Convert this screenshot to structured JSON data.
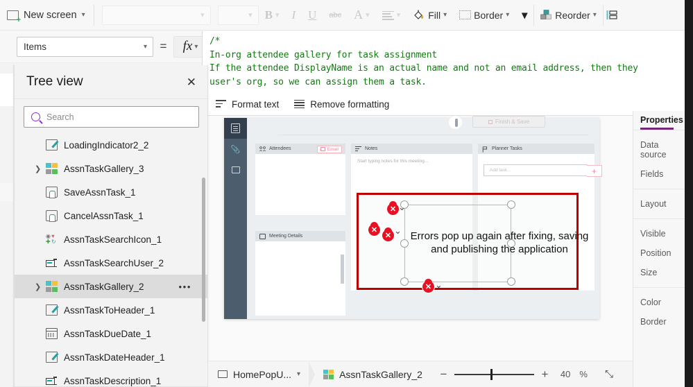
{
  "command_bar": {
    "new_screen": "New screen",
    "font_select_value": "",
    "size_select_value": "",
    "bold": "B",
    "italic": "I",
    "underline": "U",
    "strikethrough": "abc",
    "font_color": "A",
    "align": "align-icon",
    "fill": "Fill",
    "border": "Border",
    "overflow": "chevron-down",
    "reorder": "Reorder",
    "align_right": "align-icon"
  },
  "formula_bar": {
    "property": "Items",
    "equals": "=",
    "fx": "fx",
    "lines": [
      "/*",
      "In-org attendee gallery for task assignment",
      "If the attendee DisplayName is an actual name and not an email address, then they",
      "user's org, so we can assign them a task."
    ]
  },
  "format_toolbar": {
    "format_text": "Format text",
    "remove_formatting": "Remove formatting"
  },
  "tree_view": {
    "title": "Tree view",
    "close": "✕",
    "search_placeholder": "Search",
    "items": [
      {
        "label": "LoadingIndicator2_2",
        "icon": "pencil-icon",
        "expandable": false,
        "selected": false
      },
      {
        "label": "AssnTaskGallery_3",
        "icon": "gallery-icon",
        "expandable": true,
        "selected": false
      },
      {
        "label": "SaveAssnTask_1",
        "icon": "button-icon",
        "expandable": false,
        "selected": false
      },
      {
        "label": "CancelAssnTask_1",
        "icon": "button-icon",
        "expandable": false,
        "selected": false
      },
      {
        "label": "AssnTaskSearchIcon_1",
        "icon": "add-icon",
        "expandable": false,
        "selected": false
      },
      {
        "label": "AssnTaskSearchUser_2",
        "icon": "textinput-icon",
        "expandable": false,
        "selected": false
      },
      {
        "label": "AssnTaskGallery_2",
        "icon": "gallery-icon",
        "expandable": true,
        "selected": true,
        "menu": "•••"
      },
      {
        "label": "AssnTaskToHeader_1",
        "icon": "pencil-icon",
        "expandable": false,
        "selected": false
      },
      {
        "label": "AssnTaskDueDate_1",
        "icon": "calendar-icon",
        "expandable": false,
        "selected": false
      },
      {
        "label": "AssnTaskDateHeader_1",
        "icon": "pencil-icon",
        "expandable": false,
        "selected": false
      },
      {
        "label": "AssnTaskDescription_1",
        "icon": "textinput-icon",
        "expandable": false,
        "selected": false
      }
    ]
  },
  "canvas": {
    "finish_save": "Finish & Save",
    "panels": {
      "attendees": "Attendees",
      "email_badge": "Email",
      "meeting_details": "Meeting Details",
      "notes": "Notes",
      "notes_placeholder": "Start typing notes for this meeting...",
      "planner_tasks": "Planner Tasks",
      "add_task_placeholder": "Add task...",
      "add_task_button": "+"
    },
    "error_message_line1": "Errors pop up again after fixing, saving",
    "error_message_line2": "and publishing the application",
    "error_badges": 4,
    "selection_color": "#c00000",
    "error_color": "#e81123"
  },
  "properties": {
    "tab": "Properties",
    "groups": [
      [
        "Data source",
        "Fields"
      ],
      [
        "Layout"
      ],
      [
        "Visible",
        "Position",
        "Size"
      ],
      [
        "Color",
        "Border"
      ]
    ],
    "accent": "#742774"
  },
  "status_bar": {
    "screen": "HomePopU...",
    "control": "AssnTaskGallery_2",
    "zoom_minus": "−",
    "zoom_plus": "+",
    "zoom_value": "40",
    "zoom_unit": "%",
    "fit_screen": "⤡"
  }
}
